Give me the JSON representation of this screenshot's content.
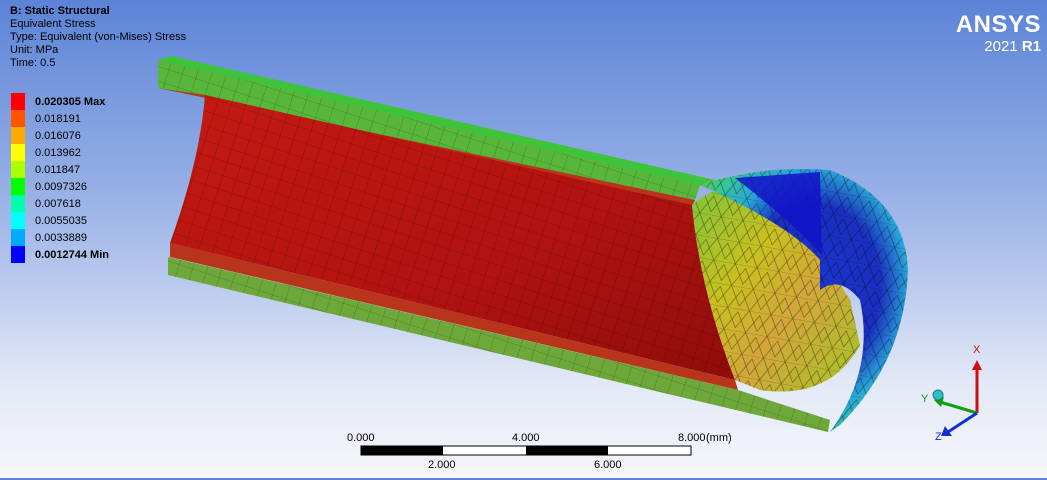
{
  "info": {
    "title": "B: Static Structural",
    "result": "Equivalent Stress",
    "type": "Type: Equivalent (von-Mises) Stress",
    "unit": "Unit: MPa",
    "time": "Time: 0.5"
  },
  "legend": {
    "entries": [
      {
        "label": "0.020305 Max",
        "color": "#ff0000",
        "bold": true
      },
      {
        "label": "0.018191",
        "color": "#ff5500",
        "bold": false
      },
      {
        "label": "0.016076",
        "color": "#ffaa00",
        "bold": false
      },
      {
        "label": "0.013962",
        "color": "#ffff00",
        "bold": false
      },
      {
        "label": "0.011847",
        "color": "#aaff00",
        "bold": false
      },
      {
        "label": "0.0097326",
        "color": "#00ff00",
        "bold": false
      },
      {
        "label": "0.007618",
        "color": "#00ffaa",
        "bold": false
      },
      {
        "label": "0.0055035",
        "color": "#00ffff",
        "bold": false
      },
      {
        "label": "0.0033889",
        "color": "#00aaff",
        "bold": false
      },
      {
        "label": "0.0012744 Min",
        "color": "#0000ff",
        "bold": true
      }
    ]
  },
  "brand": {
    "name": "ANSYS",
    "year": "2021",
    "release": "R1"
  },
  "scale_bar": {
    "top_labels": [
      "0.000",
      "4.000",
      "8.000"
    ],
    "unit": "(mm)",
    "bottom_labels": [
      "2.000",
      "6.000"
    ]
  },
  "triad": {
    "x": "X",
    "y": "Y",
    "z": "Z"
  },
  "colors": {
    "max": "#ff0000",
    "min": "#0000ff",
    "background_top": "#5b83d6"
  }
}
